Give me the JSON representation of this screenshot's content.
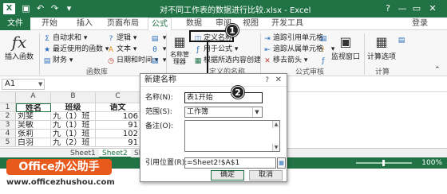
{
  "titlebar": {
    "logo": "X",
    "title": "对不同工作表的数据进行比较.xlsx - Excel",
    "help": "?",
    "minimize": "—",
    "restore": "▭",
    "close": "✕"
  },
  "menu": {
    "file": "文件",
    "tabs": [
      "开始",
      "插入",
      "页面布局",
      "公式",
      "数据",
      "审阅",
      "视图",
      "开发工具"
    ],
    "active": "公式",
    "login": "登录"
  },
  "ribbon": {
    "insert_function": "插入函数",
    "library": {
      "autosum": "自动求和",
      "recent": "最近使用的函数",
      "financial": "财务",
      "logical": "逻辑",
      "text": "文本",
      "datetime": "日期和时间",
      "group_label": "函数库"
    },
    "names": {
      "name_manager": "名称管理器",
      "define_name": "定义名称",
      "use_in_formula": "用于公式",
      "create_from_selection": "根据所选内容创建",
      "group_label": "定义的名称"
    },
    "audit": {
      "trace_precedents": "追踪引用单元格",
      "trace_dependents": "追踪从属单元格",
      "remove_arrows": "移去箭头",
      "watch_window": "监视窗口",
      "group_label": "公式审核"
    },
    "calc": {
      "options": "计算选项",
      "group_label": "计算"
    }
  },
  "formula_bar": {
    "namebox": "A1"
  },
  "grid": {
    "headers": [
      "姓名",
      "班级",
      "语文"
    ],
    "rows": [
      {
        "n": "1",
        "cells": [
          "姓名",
          "班级",
          "语文"
        ]
      },
      {
        "n": "2",
        "cells": [
          "刘斐",
          "九（1）班",
          "106"
        ]
      },
      {
        "n": "3",
        "cells": [
          "吴敏",
          "九（1）班",
          "91"
        ]
      },
      {
        "n": "4",
        "cells": [
          "张莉",
          "九（1）班",
          "102"
        ]
      },
      {
        "n": "5",
        "cells": [
          "白羽",
          "九（2）班",
          "91"
        ]
      }
    ]
  },
  "sheets": [
    "Sheet1",
    "Sheet2",
    "Sh"
  ],
  "status": {
    "zoom": "100%"
  },
  "dialog": {
    "title": "新建名称",
    "help": "?",
    "close": "✕",
    "name_label": "名称(N):",
    "name_value": "表1开始",
    "scope_label": "范围(S):",
    "scope_value": "工作簿",
    "comment_label": "备注(O):",
    "ref_label": "引用位置(R):",
    "ref_value": "=Sheet2!$A$1",
    "ok": "确定",
    "cancel": "取消"
  },
  "callouts": [
    "1",
    "2"
  ],
  "watermark": {
    "brand": "Office办公助手",
    "url": "www.officezhushou.com"
  }
}
